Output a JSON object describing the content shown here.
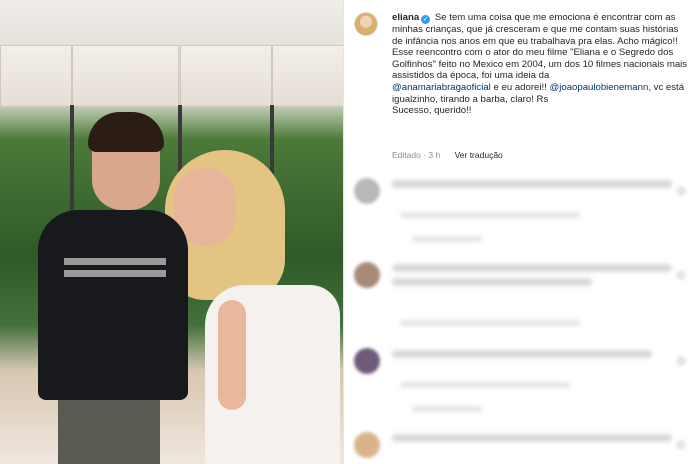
{
  "photo": {
    "alt_subject": "Two people posing in a TV studio"
  },
  "post": {
    "username": "eliana",
    "verified_icon": "verified-badge-icon",
    "caption_line1": "Se tem uma coisa que me emociona é encontrar com as minhas crianças, que já cresceram e que me contam suas histórias de infância nos anos em que eu trabalhava pra elas. Acho mágico!!",
    "caption_line2": "Esse reencontro com o ator do meu filme \"Eliana e o Segredo dos Golfinhos\" feito no Mexico em 2004, um dos 10 filmes nacionais mais assistidos da época, foi uma ideia da",
    "mention1": "@anamariabragaoficial",
    "caption_line3": " e eu adorei!! ",
    "mention2": "@joaopaulobienemann",
    "caption_line4": ", vc está igualzinho, tirando a barba, claro! Rs",
    "caption_line5": "Sucesso, querido!!",
    "edited": "Editado · 3 h",
    "translate": "Ver tradução"
  },
  "colors": {
    "link": "#00376b",
    "verified": "#3897f0",
    "meta": "#8e8e8e"
  }
}
